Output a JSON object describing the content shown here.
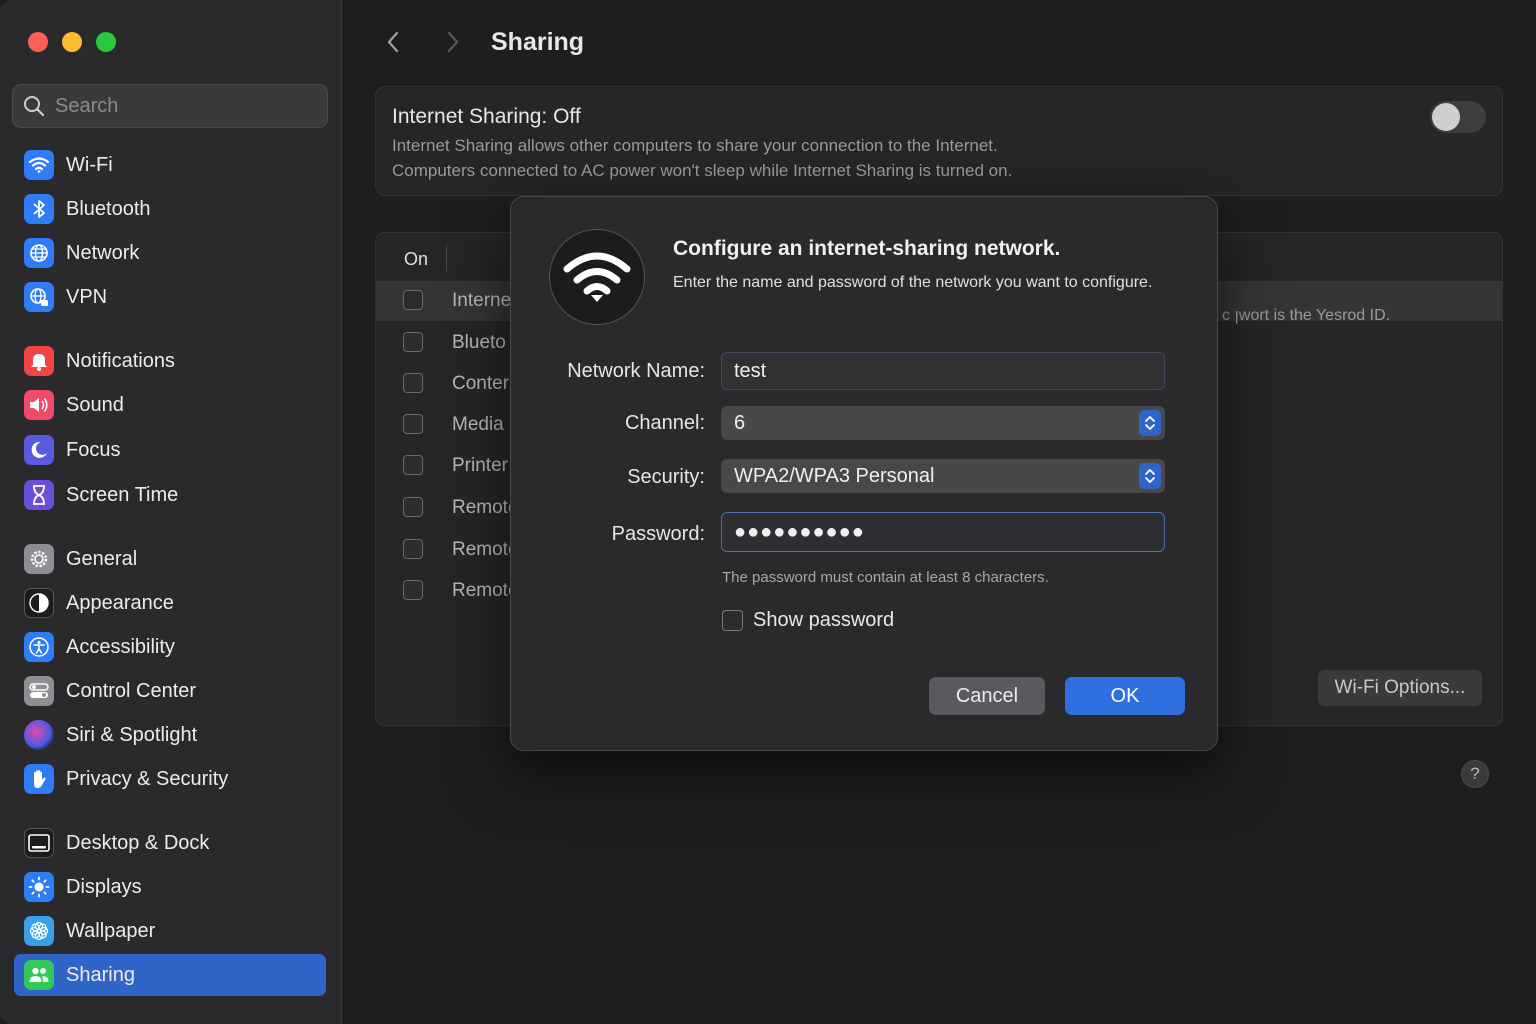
{
  "search": {
    "placeholder": "Search"
  },
  "sidebar": {
    "items": [
      {
        "label": "Wi-Fi",
        "icon": "wifi-icon",
        "color": "#2f7cf6"
      },
      {
        "label": "Bluetooth",
        "icon": "bluetooth-icon",
        "color": "#2f7cf6"
      },
      {
        "label": "Network",
        "icon": "globe-icon",
        "color": "#2f7cf6"
      },
      {
        "label": "VPN",
        "icon": "vpn-globe-icon",
        "color": "#2f7cf6"
      },
      {
        "label": "Notifications",
        "icon": "bell-icon",
        "color": "#f04545"
      },
      {
        "label": "Sound",
        "icon": "speaker-icon",
        "color": "#f04a6a"
      },
      {
        "label": "Focus",
        "icon": "moon-icon",
        "color": "#5a5ae0"
      },
      {
        "label": "Screen Time",
        "icon": "hourglass-icon",
        "color": "#6a4fd8"
      },
      {
        "label": "General",
        "icon": "gear-icon",
        "color": "#8e8e93"
      },
      {
        "label": "Appearance",
        "icon": "appearance-icon",
        "color": "#1c1c1e"
      },
      {
        "label": "Accessibility",
        "icon": "accessibility-icon",
        "color": "#2f7cf6"
      },
      {
        "label": "Control Center",
        "icon": "switches-icon",
        "color": "#8e8e93"
      },
      {
        "label": "Siri & Spotlight",
        "icon": "siri-icon",
        "color": "#6a3ad0"
      },
      {
        "label": "Privacy & Security",
        "icon": "hand-icon",
        "color": "#2f7cf6"
      },
      {
        "label": "Desktop & Dock",
        "icon": "dock-icon",
        "color": "#1c1c1e"
      },
      {
        "label": "Displays",
        "icon": "sun-icon",
        "color": "#2f7cf6"
      },
      {
        "label": "Wallpaper",
        "icon": "flower-icon",
        "color": "#3aa0e8"
      },
      {
        "label": "Sharing",
        "icon": "people-icon",
        "color": "#34c759"
      }
    ]
  },
  "header": {
    "title": "Sharing"
  },
  "internet_sharing": {
    "title": "Internet Sharing: Off",
    "desc_line1": "Internet Sharing allows other computers to share your connection to the Internet.",
    "desc_line2": "Computers connected to AC power won't sleep while Internet Sharing is turned on."
  },
  "services": {
    "col_on": "On",
    "rows": [
      "Interne",
      "Blueto",
      "Conter",
      "Media",
      "Printer",
      "Remote",
      "Remote",
      "Remote"
    ],
    "side_note": "c ꞁwort is the Yesrod ID.",
    "wifi_options": "Wi-Fi Options...",
    "help": "?"
  },
  "dialog": {
    "title": "Configure an internet-sharing network.",
    "subtitle": "Enter the name and password of the network you want to configure.",
    "network_name_label": "Network Name:",
    "network_name_value": "test",
    "channel_label": "Channel:",
    "channel_value": "6",
    "security_label": "Security:",
    "security_value": "WPA2/WPA3 Personal",
    "password_label": "Password:",
    "password_value": "●●●●●●●●●●",
    "hint": "The password must contain at least 8 characters.",
    "show_password": "Show password",
    "cancel": "Cancel",
    "ok": "OK"
  }
}
